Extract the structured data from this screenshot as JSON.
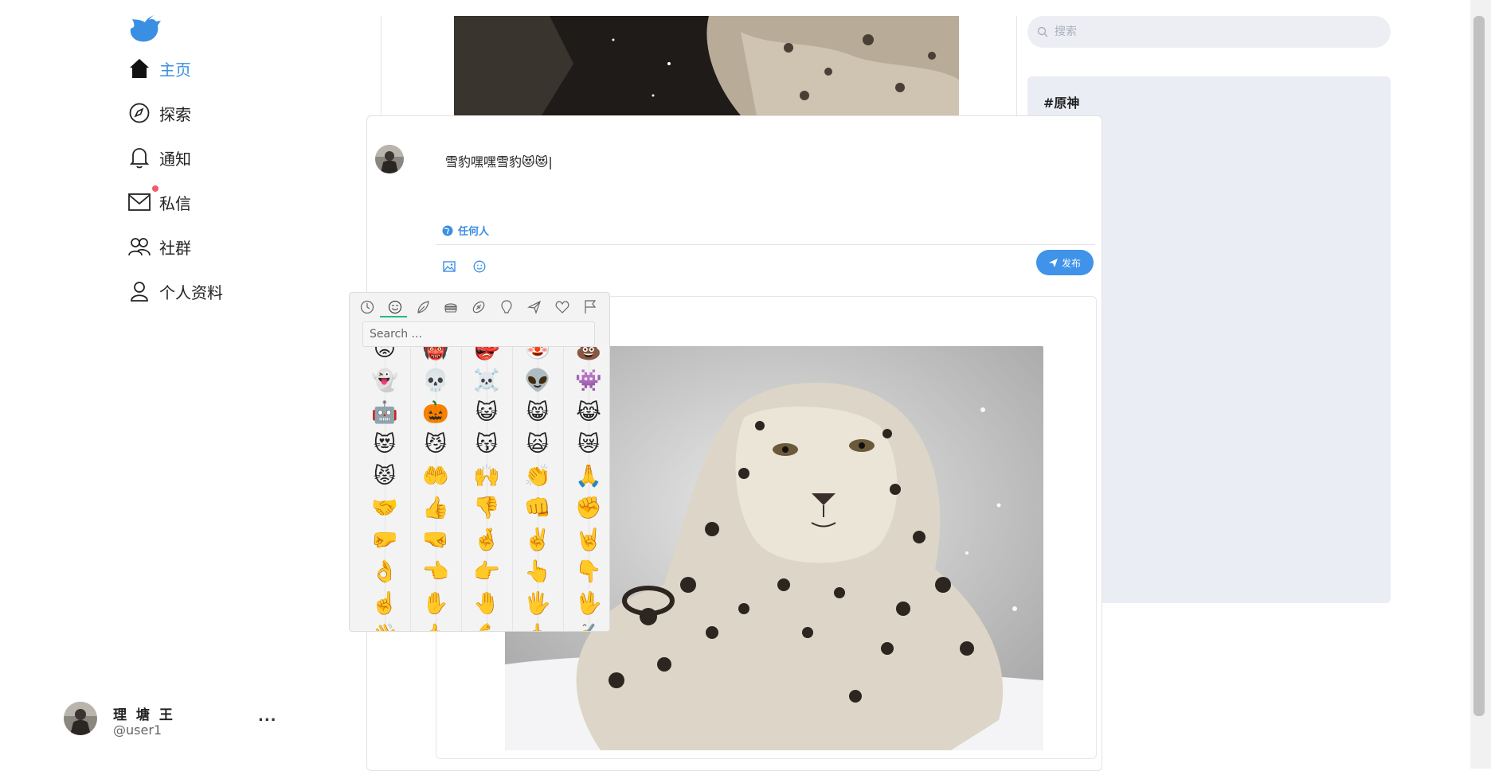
{
  "sidebar": {
    "logo_icon": "bird-logo-icon",
    "accent": "#3b8fe3",
    "items": [
      {
        "label": "主页",
        "icon": "home-icon",
        "active": true
      },
      {
        "label": "探索",
        "icon": "compass-icon"
      },
      {
        "label": "通知",
        "icon": "bell-icon"
      },
      {
        "label": "私信",
        "icon": "mail-icon",
        "badge_dot": true
      },
      {
        "label": "社群",
        "icon": "people-icon"
      },
      {
        "label": "个人资料",
        "icon": "user-icon"
      }
    ],
    "user": {
      "name": "理 塘 王",
      "handle": "@user1",
      "more": "..."
    }
  },
  "right": {
    "search_placeholder": "搜索",
    "trend_title": "#原神"
  },
  "compose": {
    "text": "雪豹嘿嘿雪豹😻😻",
    "audience": "任何人",
    "tools": [
      "image-icon",
      "emoji-icon"
    ],
    "post_label": "发布",
    "post_color": "#3f93e8"
  },
  "emoji_picker": {
    "categories": [
      "recent-icon",
      "smiley-icon",
      "nature-icon",
      "food-icon",
      "activity-icon",
      "places-icon",
      "travel-icon",
      "symbols-icon",
      "flags-icon"
    ],
    "active_category": 1,
    "search_placeholder": "Search ...",
    "emojis": [
      "😡",
      "👹",
      "👺",
      "🤡",
      "💩",
      "👻",
      "💀",
      "☠️",
      "👽",
      "👾",
      "🤖",
      "🎃",
      "😺",
      "😸",
      "😹",
      "😻",
      "😼",
      "😽",
      "🙀",
      "😿",
      "😾",
      "🤲",
      "🙌",
      "👏",
      "🙏",
      "🤝",
      "👍",
      "👎",
      "👊",
      "✊",
      "🤛",
      "🤜",
      "🤞",
      "✌️",
      "🤘",
      "👌",
      "👈",
      "👉",
      "👆",
      "👇",
      "☝️",
      "✋",
      "🤚",
      "🖐️",
      "🖖",
      "👋",
      "🤙",
      "💪",
      "🖕",
      "✍️"
    ]
  }
}
